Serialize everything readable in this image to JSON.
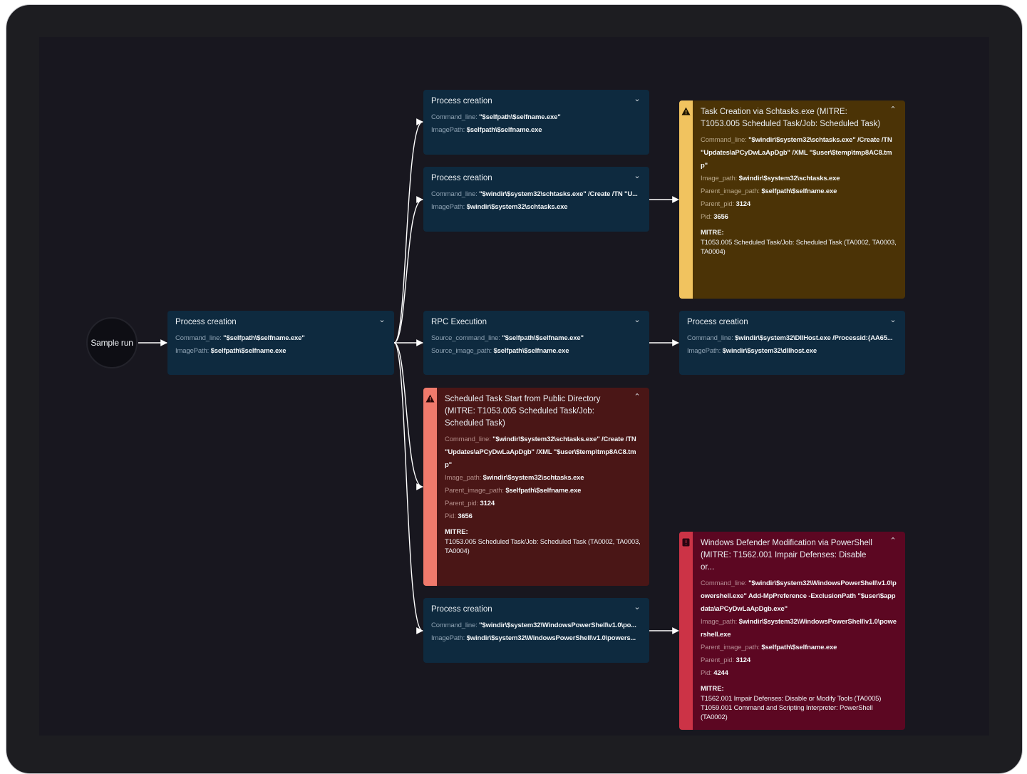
{
  "start_node": {
    "label": "Sample run"
  },
  "nodes": {
    "root": {
      "title": "Process creation",
      "rows": [
        {
          "key": "Command_line: ",
          "value": "\"$selfpath\\$selfname.exe\""
        },
        {
          "key": "ImagePath: ",
          "value": "$selfpath\\$selfname.exe"
        }
      ]
    },
    "proc_a": {
      "title": "Process creation",
      "rows": [
        {
          "key": "Command_line: ",
          "value": "\"$selfpath\\$selfname.exe\""
        },
        {
          "key": "ImagePath: ",
          "value": "$selfpath\\$selfname.exe"
        }
      ]
    },
    "proc_b": {
      "title": "Process creation",
      "rows": [
        {
          "key": "Command_line: ",
          "value": "\"$windir\\$system32\\schtasks.exe\" /Create /TN \"U..."
        },
        {
          "key": "ImagePath: ",
          "value": "$windir\\$system32\\schtasks.exe"
        }
      ]
    },
    "rpc": {
      "title": "RPC Execution",
      "rows": [
        {
          "key": "Source_command_line: ",
          "value": "\"$selfpath\\$selfname.exe\""
        },
        {
          "key": "Source_image_path: ",
          "value": "$selfpath\\$selfname.exe"
        }
      ]
    },
    "proc_dll": {
      "title": "Process creation",
      "rows": [
        {
          "key": "Command_line: ",
          "value": "$windir\\$system32\\DllHost.exe /Processid:{AA65..."
        },
        {
          "key": "ImagePath: ",
          "value": "$windir\\$system32\\dllhost.exe"
        }
      ]
    },
    "proc_ps": {
      "title": "Process creation",
      "rows": [
        {
          "key": "Command_line: ",
          "value": "\"$windir\\$system32\\WindowsPowerShell\\v1.0\\po..."
        },
        {
          "key": "ImagePath: ",
          "value": "$windir\\$system32\\WindowsPowerShell\\v1.0\\powers..."
        }
      ]
    },
    "alert_task": {
      "title": "Task Creation via Schtasks.exe (MITRE: T1053.005 Scheduled Task/Job: Scheduled Task)",
      "rows": [
        {
          "key": "Command_line: ",
          "value": "\"$windir\\$system32\\schtasks.exe\" /Create /TN \"Updates\\aPCyDwLaApDgb\" /XML \"$user\\$temp\\tmp8AC8.tmp\""
        },
        {
          "key": "Image_path: ",
          "value": "$windir\\$system32\\schtasks.exe"
        },
        {
          "key": "Parent_image_path: ",
          "value": "$selfpath\\$selfname.exe"
        },
        {
          "key": "Parent_pid: ",
          "value": "3124"
        },
        {
          "key": "Pid: ",
          "value": "3656"
        }
      ],
      "mitre_label": "MITRE:",
      "mitre_lines": [
        "T1053.005 Scheduled Task/Job: Scheduled Task (TA0002, TA0003, TA0004)"
      ]
    },
    "alert_sched": {
      "title": "Scheduled Task Start from Public Directory (MITRE: T1053.005 Scheduled Task/Job: Scheduled Task)",
      "rows": [
        {
          "key": "Command_line: ",
          "value": "\"$windir\\$system32\\schtasks.exe\" /Create /TN \"Updates\\aPCyDwLaApDgb\" /XML \"$user\\$temp\\tmp8AC8.tmp\""
        },
        {
          "key": "Image_path: ",
          "value": "$windir\\$system32\\schtasks.exe"
        },
        {
          "key": "Parent_image_path: ",
          "value": "$selfpath\\$selfname.exe"
        },
        {
          "key": "Parent_pid: ",
          "value": "3124"
        },
        {
          "key": "Pid: ",
          "value": "3656"
        }
      ],
      "mitre_label": "MITRE:",
      "mitre_lines": [
        "T1053.005 Scheduled Task/Job: Scheduled Task (TA0002, TA0003, TA0004)"
      ]
    },
    "alert_defender": {
      "title": "Windows Defender Modification via PowerShell (MITRE: T1562.001 Impair Defenses: Disable or...",
      "rows": [
        {
          "key": "Command_line: ",
          "value": "\"$windir\\$system32\\WindowsPowerShell\\v1.0\\powershell.exe\" Add-MpPreference -ExclusionPath \"$user\\$appdata\\aPCyDwLaApDgb.exe\""
        },
        {
          "key": "Image_path: ",
          "value": "$windir\\$system32\\WindowsPowerShell\\v1.0\\powershell.exe"
        },
        {
          "key": "Parent_image_path: ",
          "value": "$selfpath\\$selfname.exe"
        },
        {
          "key": "Parent_pid: ",
          "value": "3124"
        },
        {
          "key": "Pid: ",
          "value": "4244"
        }
      ],
      "mitre_label": "MITRE:",
      "mitre_lines": [
        "T1562.001 Impair Defenses: Disable or Modify Tools (TA0005)",
        "T1059.001 Command and Scripting Interpreter: PowerShell (TA0002)"
      ]
    }
  },
  "icons": {
    "expand": "chevron-down-icon",
    "collapse": "chevron-up-icon",
    "warning": "warning-icon",
    "critical": "critical-icon"
  },
  "colors": {
    "canvas": "#18171f",
    "node": "#0e2a3f",
    "alert_yellow": "#f1c35f",
    "alert_salmon": "#f07a6c",
    "alert_crimson": "#cc3346",
    "edge": "#ffffff"
  }
}
